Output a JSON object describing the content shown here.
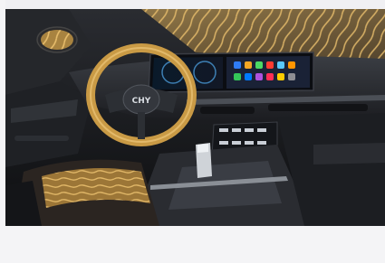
{
  "image": {
    "subject": "car-interior-heated-features",
    "accent_color": "#c99a45"
  },
  "screen": {
    "app_colors": [
      "#2f7cf6",
      "#f5a623",
      "#4cd964",
      "#ff3b30",
      "#5ac8fa",
      "#ff9500",
      "#34c759",
      "#007aff",
      "#af52de",
      "#ff2d55",
      "#ffcc00",
      "#8e8e93"
    ]
  },
  "steering": {
    "logo_text": "CHY"
  }
}
